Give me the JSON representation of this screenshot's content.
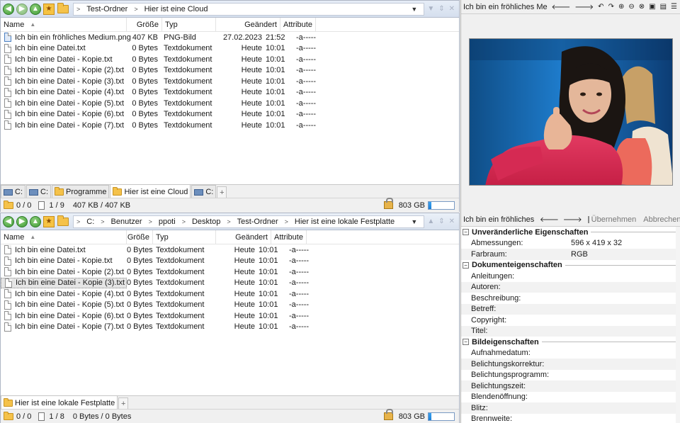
{
  "top_pane": {
    "breadcrumb": [
      "Test-Ordner",
      "Hier ist eine Cloud"
    ],
    "columns": {
      "name": "Name",
      "size": "Größe",
      "type": "Typ",
      "modified": "Geändert",
      "attributes": "Attribute"
    },
    "files": [
      {
        "name": "Ich bin ein fröhliches Medium.png",
        "size": "407 KB",
        "type": "PNG-Bild",
        "date": "27.02.2023",
        "time": "21:52",
        "attr": "-a-----",
        "icon": "image-file-icon"
      },
      {
        "name": "Ich bin eine Datei.txt",
        "size": "0 Bytes",
        "type": "Textdokument",
        "date": "Heute",
        "time": "10:01",
        "attr": "-a-----",
        "icon": "text-file-icon"
      },
      {
        "name": "Ich bin eine Datei - Kopie.txt",
        "size": "0 Bytes",
        "type": "Textdokument",
        "date": "Heute",
        "time": "10:01",
        "attr": "-a-----",
        "icon": "text-file-icon"
      },
      {
        "name": "Ich bin eine Datei - Kopie (2).txt",
        "size": "0 Bytes",
        "type": "Textdokument",
        "date": "Heute",
        "time": "10:01",
        "attr": "-a-----",
        "icon": "text-file-icon"
      },
      {
        "name": "Ich bin eine Datei - Kopie (3).txt",
        "size": "0 Bytes",
        "type": "Textdokument",
        "date": "Heute",
        "time": "10:01",
        "attr": "-a-----",
        "icon": "text-file-icon"
      },
      {
        "name": "Ich bin eine Datei - Kopie (4).txt",
        "size": "0 Bytes",
        "type": "Textdokument",
        "date": "Heute",
        "time": "10:01",
        "attr": "-a-----",
        "icon": "text-file-icon"
      },
      {
        "name": "Ich bin eine Datei - Kopie (5).txt",
        "size": "0 Bytes",
        "type": "Textdokument",
        "date": "Heute",
        "time": "10:01",
        "attr": "-a-----",
        "icon": "text-file-icon"
      },
      {
        "name": "Ich bin eine Datei - Kopie (6).txt",
        "size": "0 Bytes",
        "type": "Textdokument",
        "date": "Heute",
        "time": "10:01",
        "attr": "-a-----",
        "icon": "text-file-icon"
      },
      {
        "name": "Ich bin eine Datei - Kopie (7).txt",
        "size": "0 Bytes",
        "type": "Textdokument",
        "date": "Heute",
        "time": "10:01",
        "attr": "-a-----",
        "icon": "text-file-icon"
      }
    ],
    "tabs": [
      "C:",
      "C:",
      "Programme",
      "Hier ist eine Cloud",
      "C:"
    ],
    "tab_plus": "+",
    "status": {
      "selected": "0 / 0",
      "count": "1 / 9",
      "size": "407 KB / 407 KB",
      "free": "803 GB",
      "free_fraction": 0.1
    }
  },
  "bottom_pane": {
    "breadcrumb": [
      "C:",
      "Benutzer",
      "ppoti",
      "Desktop",
      "Test-Ordner",
      "Hier ist eine lokale Festplatte"
    ],
    "columns": {
      "name": "Name",
      "size": "Größe",
      "type": "Typ",
      "modified": "Geändert",
      "attributes": "Attribute"
    },
    "files": [
      {
        "name": "Ich bin eine Datei.txt",
        "size": "0 Bytes",
        "type": "Textdokument",
        "date": "Heute",
        "time": "10:01",
        "attr": "-a-----",
        "icon": "text-file-icon"
      },
      {
        "name": "Ich bin eine Datei - Kopie.txt",
        "size": "0 Bytes",
        "type": "Textdokument",
        "date": "Heute",
        "time": "10:01",
        "attr": "-a-----",
        "icon": "text-file-icon"
      },
      {
        "name": "Ich bin eine Datei - Kopie (2).txt",
        "size": "0 Bytes",
        "type": "Textdokument",
        "date": "Heute",
        "time": "10:01",
        "attr": "-a-----",
        "icon": "text-file-icon"
      },
      {
        "name": "Ich bin eine Datei - Kopie (3).txt",
        "size": "0 Bytes",
        "type": "Textdokument",
        "date": "Heute",
        "time": "10:01",
        "attr": "-a-----",
        "icon": "text-file-icon",
        "selected": true
      },
      {
        "name": "Ich bin eine Datei - Kopie (4).txt",
        "size": "0 Bytes",
        "type": "Textdokument",
        "date": "Heute",
        "time": "10:01",
        "attr": "-a-----",
        "icon": "text-file-icon"
      },
      {
        "name": "Ich bin eine Datei - Kopie (5).txt",
        "size": "0 Bytes",
        "type": "Textdokument",
        "date": "Heute",
        "time": "10:01",
        "attr": "-a-----",
        "icon": "text-file-icon"
      },
      {
        "name": "Ich bin eine Datei - Kopie (6).txt",
        "size": "0 Bytes",
        "type": "Textdokument",
        "date": "Heute",
        "time": "10:01",
        "attr": "-a-----",
        "icon": "text-file-icon"
      },
      {
        "name": "Ich bin eine Datei - Kopie (7).txt",
        "size": "0 Bytes",
        "type": "Textdokument",
        "date": "Heute",
        "time": "10:01",
        "attr": "-a-----",
        "icon": "text-file-icon"
      }
    ],
    "tabs": [
      "Hier ist eine lokale Festplatte"
    ],
    "tab_plus": "+",
    "status": {
      "selected": "0 / 0",
      "count": "1 / 8",
      "size": "0 Bytes / 0 Bytes",
      "free": "803 GB",
      "free_fraction": 0.1
    }
  },
  "preview_panel": {
    "title": "Ich bin ein fröhliches Medium....",
    "toolbar_icons": [
      "arrow-left-icon",
      "arrow-right-icon",
      "rotate-left-icon",
      "rotate-right-icon",
      "zoom-in-icon",
      "zoom-out-icon",
      "zoom-fit-icon",
      "fullscreen-icon",
      "window-icon",
      "menu-icon"
    ]
  },
  "properties_panel": {
    "title": "Ich bin ein fröhliches ...",
    "apply_label": "Übernehmen",
    "cancel_label": "Abbrechen",
    "sections": [
      {
        "title": "Unveränderliche Eigenschaften",
        "rows": [
          {
            "key": "Abmessungen:",
            "value": "596 x 419 x 32"
          },
          {
            "key": "Farbraum:",
            "value": "RGB"
          }
        ]
      },
      {
        "title": "Dokumenteigenschaften",
        "rows": [
          {
            "key": "Anleitungen:",
            "value": ""
          },
          {
            "key": "Autoren:",
            "value": ""
          },
          {
            "key": "Beschreibung:",
            "value": ""
          },
          {
            "key": "Betreff:",
            "value": ""
          },
          {
            "key": "Copyright:",
            "value": ""
          },
          {
            "key": "Titel:",
            "value": ""
          }
        ]
      },
      {
        "title": "Bildeigenschaften",
        "rows": [
          {
            "key": "Aufnahmedatum:",
            "value": ""
          },
          {
            "key": "Belichtungskorrektur:",
            "value": ""
          },
          {
            "key": "Belichtungsprogramm:",
            "value": ""
          },
          {
            "key": "Belichtungszeit:",
            "value": ""
          },
          {
            "key": "Blendenöffnung:",
            "value": ""
          },
          {
            "key": "Blitz:",
            "value": ""
          },
          {
            "key": "Brennweite:",
            "value": ""
          }
        ]
      }
    ]
  }
}
